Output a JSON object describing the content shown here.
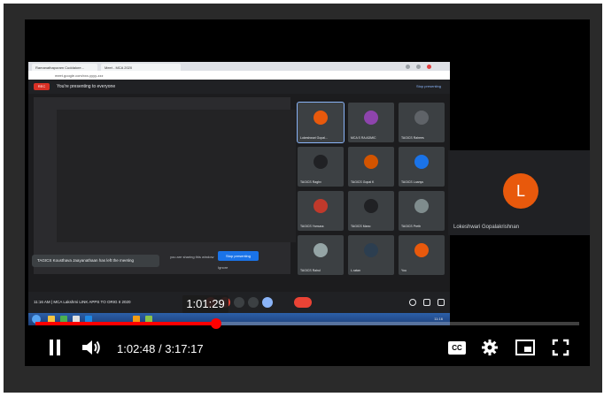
{
  "player": {
    "hover_time": "1:01:29",
    "current_time": "1:02:48",
    "separator": " / ",
    "duration": "3:17:17",
    "played_fraction": 0.332,
    "hover_fraction": 0.31,
    "cc_label": "CC"
  },
  "meeting": {
    "title": "You're presenting to everyone",
    "stop_presenting": "Stop presenting",
    "rec_label": "REC",
    "toast": "TAGICS Kousthava Jaayanathaan has left the meeting",
    "present_button": "Stop presenting",
    "share_note": "you are sharing this window",
    "ignore": "Ignore",
    "bottom_time": "11:16 AM",
    "bottom_label": "MCA Lakshmi LINK APPS TO ORIG II 2020",
    "clock": "11:16"
  },
  "side_participant": {
    "initial": "L",
    "name": "Lokeshwari Gopalakrishnan",
    "color": "#e8590c"
  },
  "grid_participants": [
    {
      "name": "Lokeshwari Gopal...",
      "color": "#e8590c",
      "active": true
    },
    {
      "name": "MCA S RA ADMIC",
      "color": "#8e44ad",
      "active": false
    },
    {
      "name": "TAGICS Rahees",
      "color": "#5f6368",
      "active": false
    },
    {
      "name": "TAGICS Raghv",
      "color": "#202124",
      "active": false
    },
    {
      "name": "TAGICS Gopal K",
      "color": "#d35400",
      "active": false
    },
    {
      "name": "TAGICS Loanys",
      "color": "#1a73e8",
      "active": false
    },
    {
      "name": "TAGICS Yamuna",
      "color": "#c0392b",
      "active": false
    },
    {
      "name": "TAGICS Mano",
      "color": "#202124",
      "active": false
    },
    {
      "name": "TAGICS Preth",
      "color": "#7f8c8d",
      "active": false
    },
    {
      "name": "TAGICS Rahul",
      "color": "#95a5a6",
      "active": false
    },
    {
      "name": "L.ratan",
      "color": "#2c3e50",
      "active": false
    },
    {
      "name": "You",
      "color": "#e8590c",
      "active": false
    }
  ],
  "browser_tabs": [
    "Ramanathapuram Cuddalore...",
    "Meet - MCA 2020"
  ],
  "address": "meet.google.com/xxx-yyyy-zzz"
}
